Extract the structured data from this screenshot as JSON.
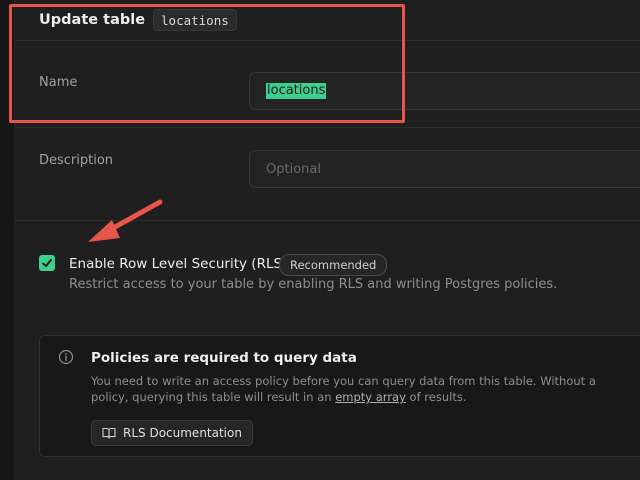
{
  "header": {
    "title": "Update table",
    "table_name": "locations"
  },
  "form": {
    "name_label": "Name",
    "name_value": "locations",
    "description_label": "Description",
    "description_placeholder": "Optional"
  },
  "rls": {
    "checked": true,
    "label": "Enable Row Level Security (RLS)",
    "badge": "Recommended",
    "description": "Restrict access to your table by enabling RLS and writing Postgres policies."
  },
  "callout": {
    "title": "Policies are required to query data",
    "body_before": "You need to write an access policy before you can query data from this table. Without a policy, querying this table will result in an ",
    "body_link": "empty array",
    "body_after": " of results.",
    "button_label": "RLS Documentation"
  },
  "icons": {
    "info": "info-icon",
    "book": "book-icon",
    "check": "check-icon",
    "arrow": "annotation-arrow"
  },
  "colors": {
    "accent": "#3ecf8e",
    "annotation": "#e8564b",
    "background": "#1f1f1f"
  }
}
